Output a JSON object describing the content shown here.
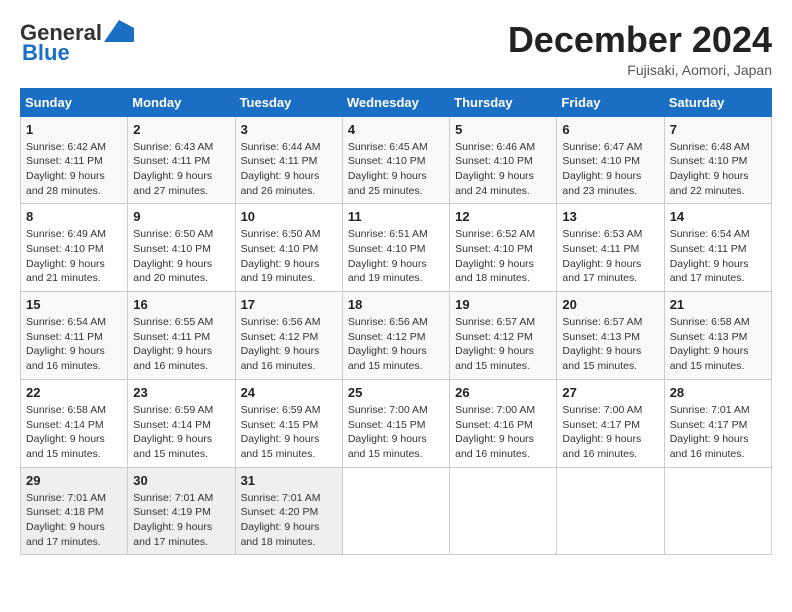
{
  "header": {
    "logo_general": "General",
    "logo_blue": "Blue",
    "month": "December 2024",
    "location": "Fujisaki, Aomori, Japan"
  },
  "days_of_week": [
    "Sunday",
    "Monday",
    "Tuesday",
    "Wednesday",
    "Thursday",
    "Friday",
    "Saturday"
  ],
  "weeks": [
    [
      {
        "day": "1",
        "sunrise": "Sunrise: 6:42 AM",
        "sunset": "Sunset: 4:11 PM",
        "daylight": "Daylight: 9 hours and 28 minutes."
      },
      {
        "day": "2",
        "sunrise": "Sunrise: 6:43 AM",
        "sunset": "Sunset: 4:11 PM",
        "daylight": "Daylight: 9 hours and 27 minutes."
      },
      {
        "day": "3",
        "sunrise": "Sunrise: 6:44 AM",
        "sunset": "Sunset: 4:11 PM",
        "daylight": "Daylight: 9 hours and 26 minutes."
      },
      {
        "day": "4",
        "sunrise": "Sunrise: 6:45 AM",
        "sunset": "Sunset: 4:10 PM",
        "daylight": "Daylight: 9 hours and 25 minutes."
      },
      {
        "day": "5",
        "sunrise": "Sunrise: 6:46 AM",
        "sunset": "Sunset: 4:10 PM",
        "daylight": "Daylight: 9 hours and 24 minutes."
      },
      {
        "day": "6",
        "sunrise": "Sunrise: 6:47 AM",
        "sunset": "Sunset: 4:10 PM",
        "daylight": "Daylight: 9 hours and 23 minutes."
      },
      {
        "day": "7",
        "sunrise": "Sunrise: 6:48 AM",
        "sunset": "Sunset: 4:10 PM",
        "daylight": "Daylight: 9 hours and 22 minutes."
      }
    ],
    [
      {
        "day": "8",
        "sunrise": "Sunrise: 6:49 AM",
        "sunset": "Sunset: 4:10 PM",
        "daylight": "Daylight: 9 hours and 21 minutes."
      },
      {
        "day": "9",
        "sunrise": "Sunrise: 6:50 AM",
        "sunset": "Sunset: 4:10 PM",
        "daylight": "Daylight: 9 hours and 20 minutes."
      },
      {
        "day": "10",
        "sunrise": "Sunrise: 6:50 AM",
        "sunset": "Sunset: 4:10 PM",
        "daylight": "Daylight: 9 hours and 19 minutes."
      },
      {
        "day": "11",
        "sunrise": "Sunrise: 6:51 AM",
        "sunset": "Sunset: 4:10 PM",
        "daylight": "Daylight: 9 hours and 19 minutes."
      },
      {
        "day": "12",
        "sunrise": "Sunrise: 6:52 AM",
        "sunset": "Sunset: 4:10 PM",
        "daylight": "Daylight: 9 hours and 18 minutes."
      },
      {
        "day": "13",
        "sunrise": "Sunrise: 6:53 AM",
        "sunset": "Sunset: 4:11 PM",
        "daylight": "Daylight: 9 hours and 17 minutes."
      },
      {
        "day": "14",
        "sunrise": "Sunrise: 6:54 AM",
        "sunset": "Sunset: 4:11 PM",
        "daylight": "Daylight: 9 hours and 17 minutes."
      }
    ],
    [
      {
        "day": "15",
        "sunrise": "Sunrise: 6:54 AM",
        "sunset": "Sunset: 4:11 PM",
        "daylight": "Daylight: 9 hours and 16 minutes."
      },
      {
        "day": "16",
        "sunrise": "Sunrise: 6:55 AM",
        "sunset": "Sunset: 4:11 PM",
        "daylight": "Daylight: 9 hours and 16 minutes."
      },
      {
        "day": "17",
        "sunrise": "Sunrise: 6:56 AM",
        "sunset": "Sunset: 4:12 PM",
        "daylight": "Daylight: 9 hours and 16 minutes."
      },
      {
        "day": "18",
        "sunrise": "Sunrise: 6:56 AM",
        "sunset": "Sunset: 4:12 PM",
        "daylight": "Daylight: 9 hours and 15 minutes."
      },
      {
        "day": "19",
        "sunrise": "Sunrise: 6:57 AM",
        "sunset": "Sunset: 4:12 PM",
        "daylight": "Daylight: 9 hours and 15 minutes."
      },
      {
        "day": "20",
        "sunrise": "Sunrise: 6:57 AM",
        "sunset": "Sunset: 4:13 PM",
        "daylight": "Daylight: 9 hours and 15 minutes."
      },
      {
        "day": "21",
        "sunrise": "Sunrise: 6:58 AM",
        "sunset": "Sunset: 4:13 PM",
        "daylight": "Daylight: 9 hours and 15 minutes."
      }
    ],
    [
      {
        "day": "22",
        "sunrise": "Sunrise: 6:58 AM",
        "sunset": "Sunset: 4:14 PM",
        "daylight": "Daylight: 9 hours and 15 minutes."
      },
      {
        "day": "23",
        "sunrise": "Sunrise: 6:59 AM",
        "sunset": "Sunset: 4:14 PM",
        "daylight": "Daylight: 9 hours and 15 minutes."
      },
      {
        "day": "24",
        "sunrise": "Sunrise: 6:59 AM",
        "sunset": "Sunset: 4:15 PM",
        "daylight": "Daylight: 9 hours and 15 minutes."
      },
      {
        "day": "25",
        "sunrise": "Sunrise: 7:00 AM",
        "sunset": "Sunset: 4:15 PM",
        "daylight": "Daylight: 9 hours and 15 minutes."
      },
      {
        "day": "26",
        "sunrise": "Sunrise: 7:00 AM",
        "sunset": "Sunset: 4:16 PM",
        "daylight": "Daylight: 9 hours and 16 minutes."
      },
      {
        "day": "27",
        "sunrise": "Sunrise: 7:00 AM",
        "sunset": "Sunset: 4:17 PM",
        "daylight": "Daylight: 9 hours and 16 minutes."
      },
      {
        "day": "28",
        "sunrise": "Sunrise: 7:01 AM",
        "sunset": "Sunset: 4:17 PM",
        "daylight": "Daylight: 9 hours and 16 minutes."
      }
    ],
    [
      {
        "day": "29",
        "sunrise": "Sunrise: 7:01 AM",
        "sunset": "Sunset: 4:18 PM",
        "daylight": "Daylight: 9 hours and 17 minutes."
      },
      {
        "day": "30",
        "sunrise": "Sunrise: 7:01 AM",
        "sunset": "Sunset: 4:19 PM",
        "daylight": "Daylight: 9 hours and 17 minutes."
      },
      {
        "day": "31",
        "sunrise": "Sunrise: 7:01 AM",
        "sunset": "Sunset: 4:20 PM",
        "daylight": "Daylight: 9 hours and 18 minutes."
      },
      null,
      null,
      null,
      null
    ]
  ]
}
